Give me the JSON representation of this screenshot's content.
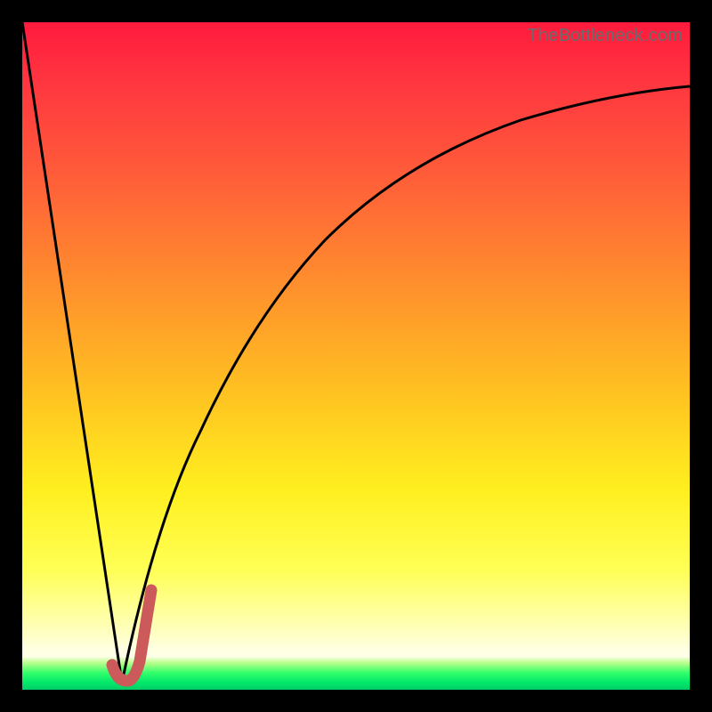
{
  "watermark": "TheBottleneck.com",
  "colors": {
    "black_frame": "#000000",
    "curve_stroke": "#000000",
    "marker_stroke": "#cc5a5a",
    "gradient_top": "#ff1a3d",
    "gradient_mid": "#ffef1f",
    "gradient_green": "#00e66a"
  },
  "chart_data": {
    "type": "line",
    "title": "",
    "xlabel": "",
    "ylabel": "",
    "xlim": [
      0,
      100
    ],
    "ylim": [
      0,
      100
    ],
    "grid": false,
    "legend": false,
    "series": [
      {
        "name": "left-descending-line",
        "x": [
          0,
          15
        ],
        "y": [
          100,
          1
        ]
      },
      {
        "name": "right-saturating-curve",
        "x": [
          15,
          17,
          20,
          25,
          30,
          35,
          40,
          50,
          60,
          70,
          80,
          90,
          100
        ],
        "y": [
          1,
          8,
          20,
          36,
          48,
          57,
          64,
          74,
          80,
          84,
          87,
          89,
          90
        ]
      }
    ],
    "marker": {
      "name": "j-marker",
      "points_xy": [
        [
          13.5,
          3.0
        ],
        [
          14.5,
          1.2
        ],
        [
          16.0,
          1.2
        ],
        [
          17.0,
          4.0
        ],
        [
          19.3,
          15.0
        ]
      ],
      "stroke_width_px": 12,
      "color": "#cc5a5a"
    },
    "note": "Axis values are in percent of the 750x750 plot area; y measured from bottom. Values estimated from pixel positions."
  }
}
